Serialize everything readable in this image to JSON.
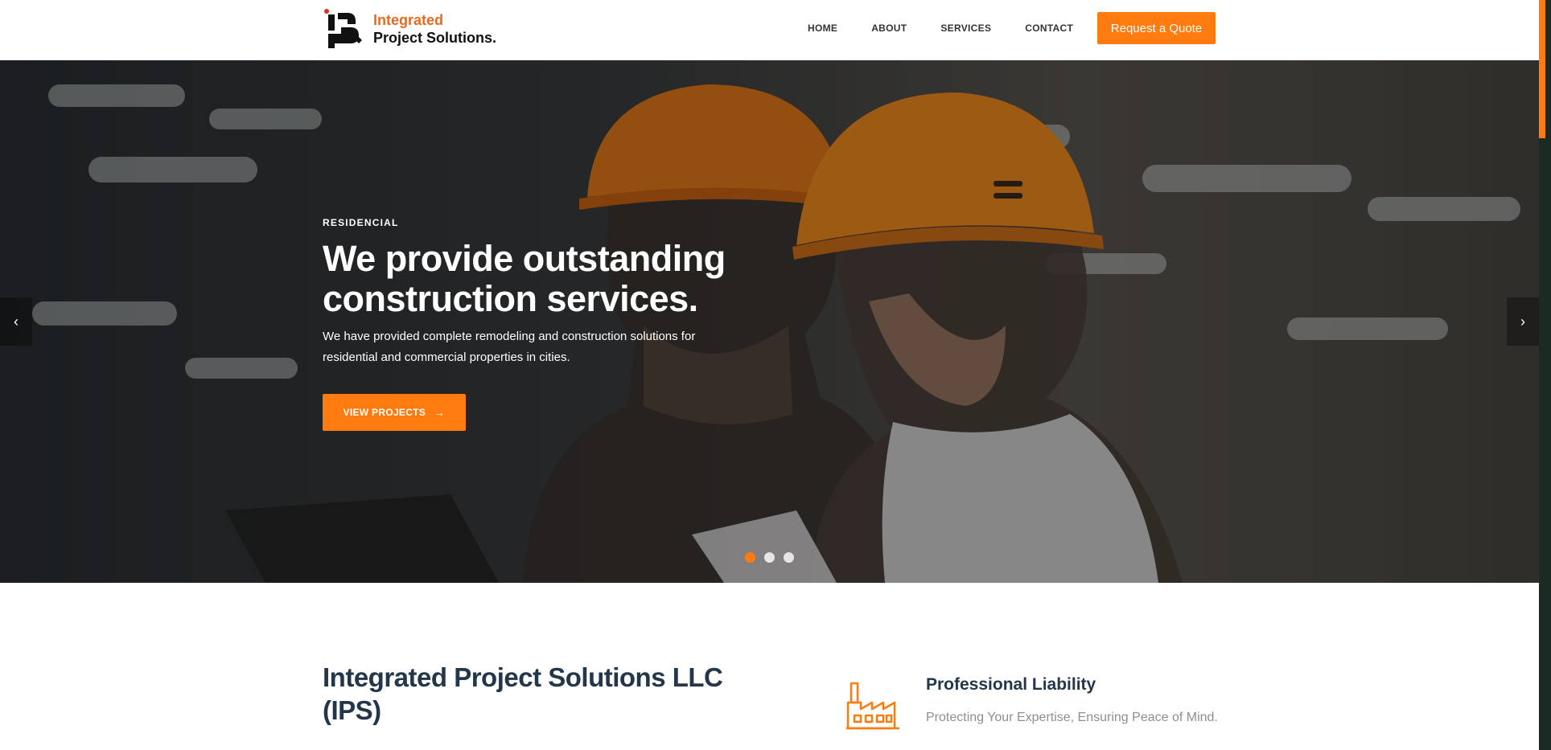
{
  "colors": {
    "accent": "#ff7a0f",
    "heading": "#23364a",
    "muted": "#8a8f95"
  },
  "logo": {
    "line1": "Integrated",
    "line2": "Project Solutions."
  },
  "nav": {
    "items": [
      "HOME",
      "ABOUT",
      "SERVICES",
      "CONTACT"
    ]
  },
  "header": {
    "quote_label": "Request a Quote"
  },
  "hero": {
    "eyebrow": "RESIDENCIAL",
    "title": "We provide outstanding construction services.",
    "description": "We have provided complete remodeling and construction solutions for residential and commercial properties in cities.",
    "button_label": "VIEW PROJECTS",
    "button_icon": "arrow-right-icon",
    "slides_count": 3,
    "active_slide": 1
  },
  "intro": {
    "company_title": "Integrated Project Solutions LLC (IPS)",
    "feature": {
      "icon": "factory-icon",
      "title": "Professional Liability",
      "description": "Protecting Your Expertise, Ensuring Peace of Mind."
    }
  }
}
